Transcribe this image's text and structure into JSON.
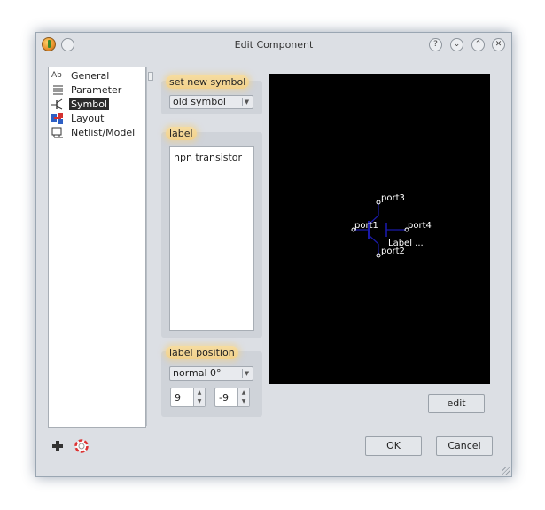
{
  "window": {
    "title": "Edit Component"
  },
  "titlebar_buttons": [
    "?",
    "⌄",
    "⌃",
    "✕"
  ],
  "tree": {
    "items": [
      {
        "label": "General",
        "icon": "text-ab-icon",
        "selected": false
      },
      {
        "label": "Parameter",
        "icon": "list-lines-icon",
        "selected": false
      },
      {
        "label": "Symbol",
        "icon": "transistor-symbol-icon",
        "selected": true
      },
      {
        "label": "Layout",
        "icon": "layout-icon",
        "selected": false
      },
      {
        "label": "Netlist/Model",
        "icon": "netlist-icon",
        "selected": false
      }
    ]
  },
  "symbol_group": {
    "title": "set new symbol",
    "combo_value": "old symbol"
  },
  "label_group": {
    "title": "label",
    "text": "npn transistor"
  },
  "position_group": {
    "title": "label position",
    "combo_value": "normal 0°",
    "x_value": "9",
    "y_value": "-9"
  },
  "symbol": {
    "ports": [
      "port3",
      "port1",
      "port4",
      "port2"
    ],
    "label_text": "Label ...",
    "stroke_color": "#1a1aa8",
    "text_color": "#ffffff"
  },
  "buttons": {
    "edit": "edit",
    "ok": "OK",
    "cancel": "Cancel"
  }
}
